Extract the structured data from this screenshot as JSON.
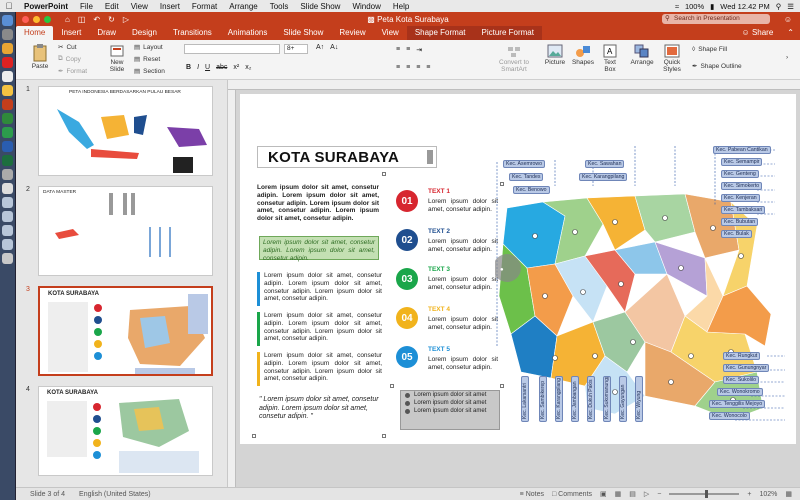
{
  "menubar": {
    "app": "PowerPoint",
    "items": [
      "File",
      "Edit",
      "View",
      "Insert",
      "Format",
      "Arrange",
      "Tools",
      "Slide Show",
      "Window",
      "Help"
    ],
    "battery": "100%",
    "battery_icon": "battery-icon",
    "clock": "Wed 12.42 PM"
  },
  "titlebar": {
    "title": "Peta Kota Surabaya",
    "search_placeholder": "Search in Presentation"
  },
  "tabs": [
    "Home",
    "Insert",
    "Draw",
    "Design",
    "Transitions",
    "Animations",
    "Slide Show",
    "Review",
    "View",
    "Shape Format",
    "Picture Format"
  ],
  "share_label": "Share",
  "ribbon": {
    "paste": "Paste",
    "cut": "Cut",
    "copy": "Copy",
    "format": "Format",
    "new_slide": "New Slide",
    "layout": "Layout",
    "reset": "Reset",
    "section": "Section",
    "font_size": "8+",
    "format_buttons": [
      "B",
      "I",
      "U",
      "abc",
      "x²",
      "x₂"
    ],
    "convert_smartart": "Convert to SmartArt",
    "picture": "Picture",
    "shapes": "Shapes",
    "text_box": "Text Box",
    "arrange": "Arrange",
    "quick_styles": "Quick Styles",
    "shape_fill": "Shape Fill",
    "shape_outline": "Shape Outline"
  },
  "thumbnails": [
    {
      "num": "1",
      "title": "PETA INDONESIA BERDASARKAN PULAU BESAR"
    },
    {
      "num": "2",
      "title": "DATA MASTER"
    },
    {
      "num": "3",
      "title": "KOTA SURABAYA"
    },
    {
      "num": "4",
      "title": "KOTA SURABAYA"
    }
  ],
  "slide": {
    "title": "KOTA SURABAYA",
    "lorem_bold": "Lorem ipsum dolor sit amet, consetur adipin. Lorem ipsum dolor sit amet, consetur adipin. Lorem ipsum dolor sit amet, consetur adipin. Lorem ipsum dolor sit amet, consetur adipin.",
    "lorem_green": "Lorem ipsum dolor sit amet, consetur adipin. Lorem ipsum dolor sit amet, consetur adipin.",
    "lorem_blocks": [
      "Lorem ipsum dolor sit amet, consetur adipin. Lorem ipsum dolor sit amet, consetur adipin. Lorem ipsum dolor sit amet, consetur adipin.",
      "Lorem ipsum dolor sit amet, consetur adipin. Lorem ipsum dolor sit amet, consetur adipin. Lorem ipsum dolor sit amet, consetur adipin.",
      "Lorem ipsum dolor sit amet, consetur adipin. Lorem ipsum dolor sit amet, consetur adipin. Lorem ipsum dolor sit amet, consetur adipin."
    ],
    "items": [
      {
        "num": "01",
        "title": "TEXT 1",
        "color": "#d7262f",
        "desc": "Lorem ipsum dolor sit amet, consetur adipin."
      },
      {
        "num": "02",
        "title": "TEXT 2",
        "color": "#1f4e8f",
        "desc": "Lorem ipsum dolor sit amet, consetur adipin."
      },
      {
        "num": "03",
        "title": "TEXT 3",
        "color": "#1aa64a",
        "desc": "Lorem ipsum dolor sit amet, consetur adipin."
      },
      {
        "num": "04",
        "title": "TEXT 4",
        "color": "#f1b31c",
        "desc": "Lorem ipsum dolor sit amet, consetur adipin."
      },
      {
        "num": "05",
        "title": "TEXT 5",
        "color": "#1d8fd6",
        "desc": "Lorem ipsum dolor sit amet, consetur adipin."
      }
    ],
    "bullets": [
      "Lorem ipsum dolor sit amet",
      "Lorem ipsum dolor sit amet",
      "Lorem ipsum dolor sit amet"
    ],
    "quote": "\" Lorem ipsum dolor sit amet, consetur adipin. Lorem ipsum dolor sit amet, consetur adipin. \"",
    "kec_top": [
      "Kec. Asemrowo",
      "Kec. Tandes",
      "Kec. Benowo",
      "Kec. Sawahan",
      "Kec. Karangpilang"
    ],
    "kec_right": [
      "Kec. Pabean Cantikan",
      "Kec. Semampir",
      "Kec. Genteng",
      "Kec. Simokerto",
      "Kec. Kenjeran",
      "Kec. Tambaksari",
      "Kec. Bubutan",
      "Kec. Bulak"
    ],
    "kec_right_bottom": [
      "Kec. Rungkut",
      "Kec. Gunungnyar",
      "Kec. Sukolilo",
      "Kec. Wonokromo",
      "Kec. Tenggilis Mejoyo",
      "Kec. Wonocolo"
    ],
    "kec_bottom": [
      "Kec. Lakarsantri",
      "Kec. Sambikerep",
      "Kec. Karangpilang",
      "Kec. Jambangan",
      "Kec. Dukuh Pakis",
      "Kec. Sukomanunggal",
      "Kec. Gayungan",
      "Kec. Wiyung"
    ]
  },
  "status": {
    "slide": "Slide 3 of 4",
    "lang": "English (United States)",
    "notes": "Notes",
    "comments": "Comments",
    "zoom": "102%"
  },
  "colors": {
    "brand": "#c43e1c"
  }
}
